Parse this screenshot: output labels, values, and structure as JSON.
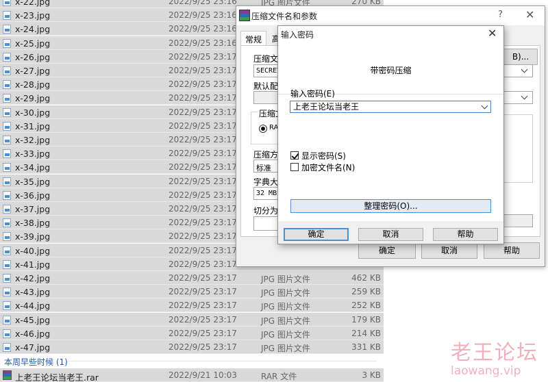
{
  "files": [
    {
      "name": "x-22.jpg",
      "date": "2022/9/25 23:16",
      "type": "JPG 图片文件",
      "size": "270 KB"
    },
    {
      "name": "x-23.jpg",
      "date": "2022/9/25 23:16",
      "type": "",
      "size": ""
    },
    {
      "name": "x-24.jpg",
      "date": "2022/9/25 23:16",
      "type": "",
      "size": ""
    },
    {
      "name": "x-25.jpg",
      "date": "2022/9/25 23:16",
      "type": "",
      "size": ""
    },
    {
      "name": "x-26.jpg",
      "date": "2022/9/25 23:17",
      "type": "",
      "size": ""
    },
    {
      "name": "x-27.jpg",
      "date": "2022/9/25 23:17",
      "type": "",
      "size": ""
    },
    {
      "name": "x-28.jpg",
      "date": "2022/9/25 23:17",
      "type": "",
      "size": ""
    },
    {
      "name": "x-29.jpg",
      "date": "2022/9/25 23:17",
      "type": "",
      "size": ""
    },
    {
      "name": "x-30.jpg",
      "date": "2022/9/25 23:17",
      "type": "",
      "size": ""
    },
    {
      "name": "x-31.jpg",
      "date": "2022/9/25 23:17",
      "type": "",
      "size": ""
    },
    {
      "name": "x-32.jpg",
      "date": "2022/9/25 23:17",
      "type": "",
      "size": ""
    },
    {
      "name": "x-33.jpg",
      "date": "2022/9/25 23:17",
      "type": "",
      "size": ""
    },
    {
      "name": "x-34.jpg",
      "date": "2022/9/25 23:17",
      "type": "",
      "size": ""
    },
    {
      "name": "x-35.jpg",
      "date": "2022/9/25 23:17",
      "type": "",
      "size": ""
    },
    {
      "name": "x-36.jpg",
      "date": "2022/9/25 23:17",
      "type": "",
      "size": ""
    },
    {
      "name": "x-37.jpg",
      "date": "2022/9/25 23:17",
      "type": "",
      "size": ""
    },
    {
      "name": "x-38.jpg",
      "date": "2022/9/25 23:17",
      "type": "",
      "size": ""
    },
    {
      "name": "x-39.jpg",
      "date": "2022/9/25 23:17",
      "type": "",
      "size": ""
    },
    {
      "name": "x-40.jpg",
      "date": "2022/9/25 23:17",
      "type": "",
      "size": ""
    },
    {
      "name": "x-41.jpg",
      "date": "2022/9/25 23:17",
      "type": "",
      "size": ""
    },
    {
      "name": "x-42.jpg",
      "date": "2022/9/25 23:17",
      "type": "JPG 图片文件",
      "size": "462 KB"
    },
    {
      "name": "x-43.jpg",
      "date": "2022/9/25 23:17",
      "type": "JPG 图片文件",
      "size": "259 KB"
    },
    {
      "name": "x-44.jpg",
      "date": "2022/9/25 23:17",
      "type": "JPG 图片文件",
      "size": "252 KB"
    },
    {
      "name": "x-45.jpg",
      "date": "2022/9/25 23:17",
      "type": "JPG 图片文件",
      "size": "179 KB"
    },
    {
      "name": "x-46.jpg",
      "date": "2022/9/25 23:17",
      "type": "JPG 图片文件",
      "size": "214 KB"
    },
    {
      "name": "x-47.jpg",
      "date": "2022/9/25 23:17",
      "type": "JPG 图片文件",
      "size": "331 KB"
    }
  ],
  "group_header": "本周早些时候 (1)",
  "rar_file": {
    "name": "上老王论坛当老王.rar",
    "date": "2022/9/21 10:03",
    "type": "RAR 文件",
    "size": "3 KB"
  },
  "back_dialog": {
    "title": "压缩文件名和参数",
    "help_glyph": "?",
    "close_glyph": "✕",
    "tab_general": "常规",
    "tab_advanced": "高",
    "archive_name_label": "压缩文",
    "archive_name_value": "SECRET",
    "browse_label": "B)...",
    "default_profile_label": "默认配",
    "archive_format_label": "压缩文",
    "format_radio_label": "RA",
    "method_label": "压缩方",
    "method_value": "标准",
    "dict_label": "字典大",
    "dict_value": "32 MB",
    "split_label": "切分为",
    "ok_label": "确定",
    "cancel_label": "取消",
    "help_label": "帮助"
  },
  "password_dialog": {
    "title": "输入密码",
    "close_glyph": "✕",
    "header": "带密码压缩",
    "password_label": "输入密码(E)",
    "password_value": "上老王论坛当老王",
    "show_password_label": "显示密码(S)",
    "show_password_checked": true,
    "encrypt_names_label": "加密文件名(N)",
    "encrypt_names_checked": false,
    "organize_button": "整理密码(O)...",
    "ok_label": "确定",
    "cancel_label": "取消",
    "help_label": "帮助"
  },
  "watermark": {
    "main": "老王论坛",
    "sub": "laowang.vip"
  }
}
